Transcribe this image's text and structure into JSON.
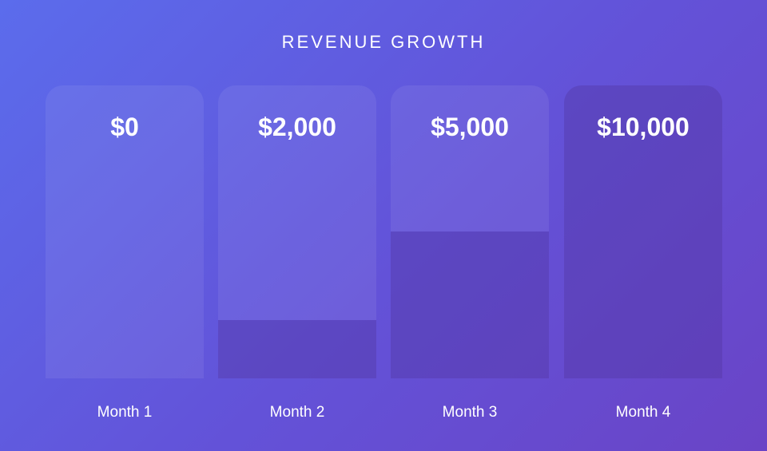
{
  "chart_data": {
    "type": "bar",
    "title": "REVENUE GROWTH",
    "categories": [
      "Month 1",
      "Month 2",
      "Month 3",
      "Month 4"
    ],
    "values": [
      0,
      2000,
      5000,
      10000
    ],
    "value_labels": [
      "$0",
      "$2,000",
      "$5,000",
      "$10,000"
    ],
    "ylim": [
      0,
      10000
    ],
    "grid": false,
    "legend": "none",
    "colors": {
      "background_start": "#5b6cec",
      "background_end": "#6a44c6",
      "text": "#ffffff"
    }
  }
}
